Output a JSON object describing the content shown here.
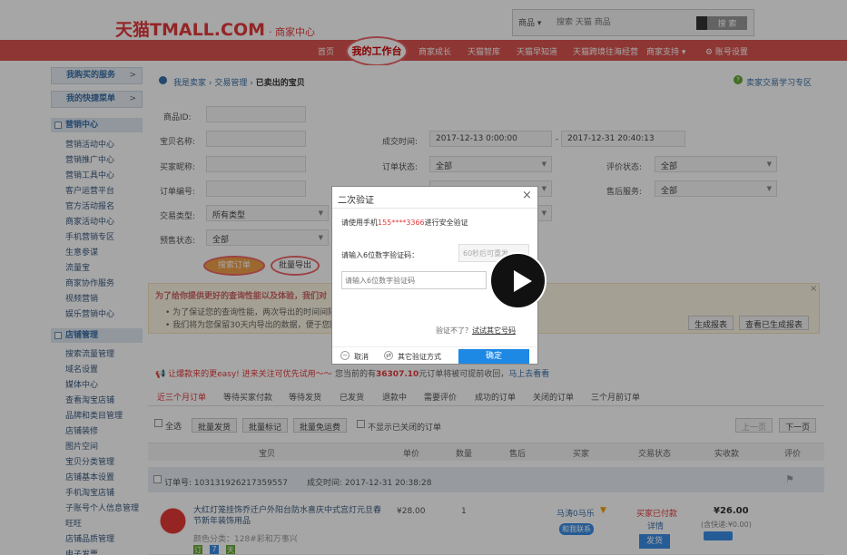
{
  "header": {
    "logo_main": "天猫TMALL.COM",
    "logo_sub": "· 商家中心",
    "search_category": "商品 ▾",
    "search_placeholder": "搜索 天猫 商品",
    "search_button": "搜 索"
  },
  "nav": {
    "items": [
      "首页",
      "我的工作台",
      "商家成长",
      "天猫智库",
      "天猫早知道",
      "天猫跨境往海经营",
      "商家支持 ▾",
      "⚙ 账号设置"
    ]
  },
  "sidebar": {
    "top_buttons": [
      {
        "label": "我购买的服务",
        "arrow": ">"
      },
      {
        "label": "我的快捷菜单",
        "arrow": ">"
      }
    ],
    "group_marketing": "营销中心",
    "marketing_items": [
      "营销活动中心",
      "营销推广中心",
      "营销工具中心",
      "客户运营平台",
      "官方活动报名",
      "商家活动中心",
      "手机营销专区",
      "生意参谋",
      "流量宝",
      "商家协作服务",
      "视频营销",
      "娱乐营销中心"
    ],
    "group_store": "店铺管理",
    "store_items": [
      "搜索流量管理",
      "域名设置",
      "媒体中心",
      "查看淘宝店铺",
      "品牌和类目管理",
      "店铺装修",
      "图片空间",
      "宝贝分类管理",
      "店铺基本设置",
      "手机淘宝店铺",
      "子账号个人信息管理",
      "旺旺",
      "店铺品质管理",
      "电子发票"
    ]
  },
  "breadcrumb": {
    "items": [
      "我是卖家",
      "交易管理"
    ],
    "current": "已卖出的宝贝",
    "help": "卖家交易学习专区"
  },
  "filters": {
    "product_id_label": "商品ID:",
    "product_name_label": "宝贝名称:",
    "buyer_label": "买家昵称:",
    "order_no_label": "订单编号:",
    "trade_type_label": "交易类型:",
    "trade_type_value": "所有类型",
    "presale_label": "预售状态:",
    "presale_value": "全部",
    "deal_time_label": "成交时间:",
    "deal_time_start": "2017-12-13 0:00:00",
    "deal_time_sep": "-",
    "deal_time_end": "2017-12-31 20:40:13",
    "order_status_label": "订单状态:",
    "order_status_value": "全部",
    "review_status_label": "评价状态:",
    "review_status_value": "全部",
    "after_sale_label": "售后服务:",
    "after_sale_value": "全部",
    "search_button": "搜索订单",
    "export_button": "批量导出"
  },
  "notice": {
    "title": "为了给你提供更好的查询性能以及体验，我们对",
    "bullet1": "为了保证您的查询性能，两次导出的时间间隔",
    "bullet2": "我们将为您保留30天内导出的数据，便于您随",
    "btn_report": "生成报表",
    "btn_view": "查看已生成报表"
  },
  "promo": {
    "left": "让爆款来的更easy! 进来关注可优先试用～～",
    "right_prefix": "您当前的有",
    "amount": "36307.10",
    "right_suffix": "元订单将被可提前收回，",
    "link": "马上去看看"
  },
  "tabs": [
    "近三个月订单",
    "等待买家付款",
    "等待发货",
    "已发货",
    "退款中",
    "需要评价",
    "成功的订单",
    "关闭的订单",
    "三个月前订单"
  ],
  "toolbar": {
    "select_all": "全选",
    "batch_ship": "批量发货",
    "batch_mark": "批量标记",
    "batch_free": "批量免运费",
    "hide_closed": "不显示已关闭的订单",
    "prev": "上一页",
    "next": "下一页"
  },
  "table_headers": [
    "宝贝",
    "单价",
    "数量",
    "售后",
    "买家",
    "交易状态",
    "实收款",
    "评价"
  ],
  "order": {
    "order_no_label": "订单号: ",
    "order_no": "103131926217359557",
    "deal_time_label": "成交时间: ",
    "deal_time": "2017-12-31 20:38:28",
    "item_title": "大红灯笼挂饰乔迁户外阳台防水喜庆中式宫灯元旦春节新年装饰用品",
    "item_spec": "颜色分类：128#彩和万事兴",
    "price": "¥28.00",
    "qty": "1",
    "buyer": "马涛0马乐",
    "buyer_contact": "和我联系",
    "status": "买家已付款",
    "status_detail": "详情",
    "ship_button": "发货",
    "received": "¥26.00",
    "shipping_note": "(含快递:¥0.00)",
    "tags": [
      "订",
      "7",
      "天"
    ]
  },
  "modal": {
    "title": "二次验证",
    "close": "×",
    "line_prefix": "请使用手机",
    "phone": "155****3366",
    "line_suffix": "进行安全验证",
    "code_label": "请输入6位数字验证码：",
    "send_button": "60秒后可重发",
    "code_placeholder": "请输入6位数字验证码",
    "no_code": "验证不了？",
    "try_other": "试试其它号码",
    "cancel": "取消",
    "other_method": "其它验证方式",
    "confirm": "确定"
  },
  "colors": {
    "brand_red": "#d9534f",
    "link_blue": "#3a6fa8",
    "confirm_blue": "#1e88e5",
    "price_orange": "#e4393c"
  }
}
